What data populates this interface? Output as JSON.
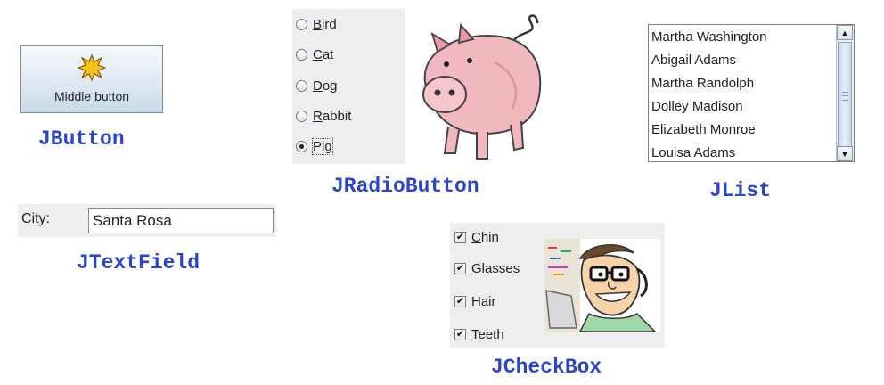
{
  "jbutton": {
    "mnemonic": "M",
    "label_rest": "iddle button",
    "icon": "star-burst-icon",
    "caption": "JButton"
  },
  "jradiobutton": {
    "options": [
      {
        "mnemonic": "B",
        "rest": "ird",
        "selected": false
      },
      {
        "mnemonic": "C",
        "rest": "at",
        "selected": false
      },
      {
        "mnemonic": "D",
        "rest": "og",
        "selected": false
      },
      {
        "mnemonic": "R",
        "rest": "abbit",
        "selected": false
      },
      {
        "mnemonic": "P",
        "rest": "ig",
        "selected": true
      }
    ],
    "image": "pig-illustration",
    "caption": "JRadioButton"
  },
  "jlist": {
    "items": [
      "Martha Washington",
      "Abigail Adams",
      "Martha Randolph",
      "Dolley Madison",
      "Elizabeth Monroe",
      "Louisa Adams"
    ],
    "caption": "JList"
  },
  "jtextfield": {
    "label": "City:",
    "value": "Santa Rosa",
    "caption": "JTextField"
  },
  "jcheckbox": {
    "options": [
      {
        "mnemonic": "C",
        "rest": "hin",
        "checked": true
      },
      {
        "mnemonic": "G",
        "rest": "lasses",
        "checked": true
      },
      {
        "mnemonic": "H",
        "rest": "air",
        "checked": true
      },
      {
        "mnemonic": "T",
        "rest": "eeth",
        "checked": true
      }
    ],
    "image": "cartoon-face-illustration",
    "caption": "JCheckBox"
  },
  "colors": {
    "caption": "#2a46c4",
    "panel": "#eeeeee",
    "pig": "#f2b8c0"
  }
}
